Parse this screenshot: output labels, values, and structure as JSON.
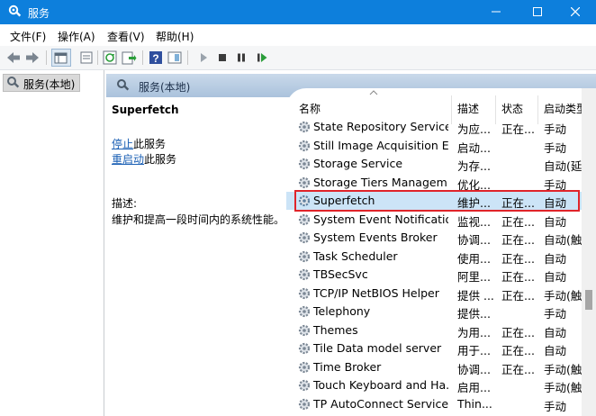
{
  "window": {
    "title": "服务"
  },
  "menu": [
    "文件(F)",
    "操作(A)",
    "查看(V)",
    "帮助(H)"
  ],
  "tree": {
    "root_label": "服务(本地)"
  },
  "content_header": {
    "label": "服务(本地)"
  },
  "detail": {
    "service_name": "Superfetch",
    "stop_link": "停止",
    "stop_suffix": "此服务",
    "restart_link": "重启动",
    "restart_suffix": "此服务",
    "desc_label": "描述:",
    "desc_text": "维护和提高一段时间内的系统性能。"
  },
  "list": {
    "columns": {
      "name": "名称",
      "description": "描述",
      "status": "状态",
      "startup": "启动类型"
    },
    "rows": [
      {
        "name": "State Repository Service",
        "description": "为应...",
        "status": "正在...",
        "startup": "手动"
      },
      {
        "name": "Still Image Acquisition Ev...",
        "description": "启动...",
        "status": "",
        "startup": "手动"
      },
      {
        "name": "Storage Service",
        "description": "为存...",
        "status": "",
        "startup": "自动(延"
      },
      {
        "name": "Storage Tiers Managem...",
        "description": "优化...",
        "status": "",
        "startup": "手动"
      },
      {
        "name": "Superfetch",
        "description": "维护...",
        "status": "正在...",
        "startup": "自动"
      },
      {
        "name": "System Event Notification...",
        "description": "监视...",
        "status": "正在...",
        "startup": "自动"
      },
      {
        "name": "System Events Broker",
        "description": "协调...",
        "status": "正在...",
        "startup": "自动(触"
      },
      {
        "name": "Task Scheduler",
        "description": "使用...",
        "status": "正在...",
        "startup": "自动"
      },
      {
        "name": "TBSecSvc",
        "description": "阿里...",
        "status": "正在...",
        "startup": "自动"
      },
      {
        "name": "TCP/IP NetBIOS Helper",
        "description": "提供 ...",
        "status": "正在...",
        "startup": "手动(触"
      },
      {
        "name": "Telephony",
        "description": "提供...",
        "status": "",
        "startup": "手动"
      },
      {
        "name": "Themes",
        "description": "为用...",
        "status": "正在...",
        "startup": "自动"
      },
      {
        "name": "Tile Data model server",
        "description": "用于...",
        "status": "正在...",
        "startup": "自动"
      },
      {
        "name": "Time Broker",
        "description": "协调...",
        "status": "正在...",
        "startup": "手动(触"
      },
      {
        "name": "Touch Keyboard and Ha...",
        "description": "启用...",
        "status": "",
        "startup": "手动(触"
      },
      {
        "name": "TP AutoConnect Service",
        "description": "Thin...",
        "status": "",
        "startup": "手动"
      }
    ],
    "selected_index": 4
  },
  "colors": {
    "titlebar": "#0d7fdc",
    "highlight_border": "#e0242a",
    "selection": "#cce4f7",
    "link": "#1a5fb4"
  }
}
